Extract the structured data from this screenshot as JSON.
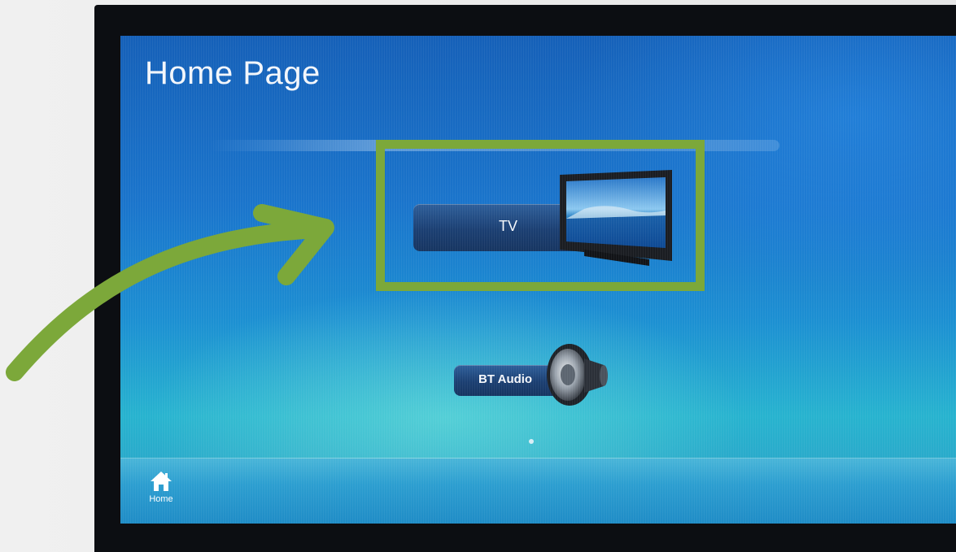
{
  "screen": {
    "title": "Home Page"
  },
  "tiles": [
    {
      "label": "TV",
      "icon": "television-icon"
    },
    {
      "label": "BT Audio",
      "icon": "speaker-icon"
    }
  ],
  "bottom_bar": {
    "home_label": "Home",
    "home_icon": "home-icon"
  },
  "colors": {
    "highlight": "#7ca83a",
    "arrow": "#7ca83a",
    "screen_top": "#1560b8",
    "screen_bottom": "#27b3cf"
  }
}
